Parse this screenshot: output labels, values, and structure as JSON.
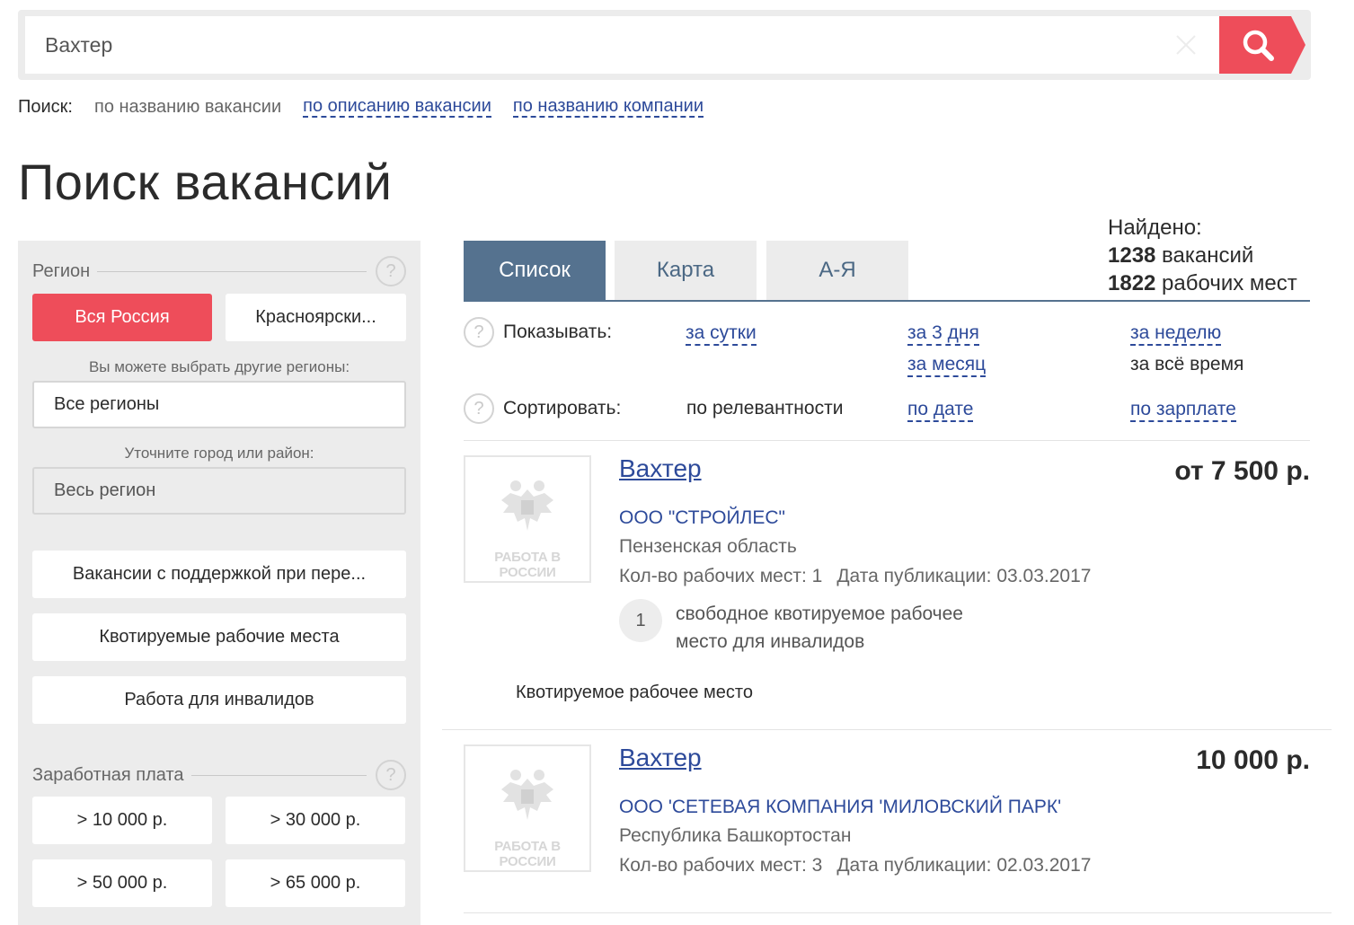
{
  "search": {
    "placeholder": "",
    "value": "Вахтер",
    "mode_label": "Поиск:",
    "mode_current": "по названию вакансии",
    "mode_links": [
      "по описанию вакансии",
      "по названию компании"
    ]
  },
  "page_title": "Поиск вакансий",
  "sidebar": {
    "region_title": "Регион",
    "help_glyph": "?",
    "region_active": "Вся Россия",
    "region_alt": "Красноярски...",
    "other_regions_caption": "Вы можете выбрать другие регионы:",
    "other_regions_value": "Все регионы",
    "city_caption": "Уточните город или район:",
    "city_value": "Весь регион",
    "buttons": [
      "Вакансии с поддержкой при пере...",
      "Квотируемые рабочие места",
      "Работа для инвалидов"
    ],
    "salary_title": "Заработная плата",
    "salary_options": [
      "> 10 000 р.",
      "> 30 000 р.",
      "> 50 000 р.",
      "> 65 000 р."
    ]
  },
  "tabs": [
    "Список",
    "Карта",
    "А-Я"
  ],
  "found": {
    "label": "Найдено:",
    "vacancies_count": "1238",
    "vacancies_label": " вакансий",
    "places_count": "1822",
    "places_label": " рабочих мест"
  },
  "filters": {
    "show_label": "Показывать:",
    "show_options": {
      "day": "за сутки",
      "three_days": "за 3 дня",
      "week": "за неделю",
      "month": "за месяц",
      "all_time": "за всё время"
    },
    "sort_label": "Сортировать:",
    "sort_options": {
      "relevance": "по релевантности",
      "date": "по дате",
      "salary": "по зарплате"
    }
  },
  "vacancies": [
    {
      "title": "Вахтер",
      "salary": "от 7 500 р.",
      "company": "ООО \"СТРОЙЛЕС\"",
      "region": "Пензенская область",
      "places": "Кол-во рабочих мест: 1",
      "published": "Дата публикации: 03.03.2017",
      "quota_count": "1",
      "quota_text": "свободное квотируемое рабочее место для инвалидов",
      "quota_note": "Квотируемое рабочее место",
      "logo_text": "РАБОТА В РОССИИ"
    },
    {
      "title": "Вахтер",
      "salary": "10 000 р.",
      "company": "ООО 'СЕТЕВАЯ КОМПАНИЯ 'МИЛОВСКИЙ ПАРК'",
      "region": "Республика Башкортостан",
      "places": "Кол-во рабочих мест: 3",
      "published": "Дата публикации: 02.03.2017",
      "logo_text": "РАБОТА В РОССИИ"
    }
  ],
  "colors": {
    "accent_red": "#ee4d5a",
    "tab_active": "#55728f",
    "link_blue": "#2d4a9a",
    "panel_gray": "#ececec"
  },
  "icons": {
    "search": "search-icon",
    "clear": "close-icon",
    "help": "question-icon",
    "logo": "coat-of-arms-icon"
  }
}
